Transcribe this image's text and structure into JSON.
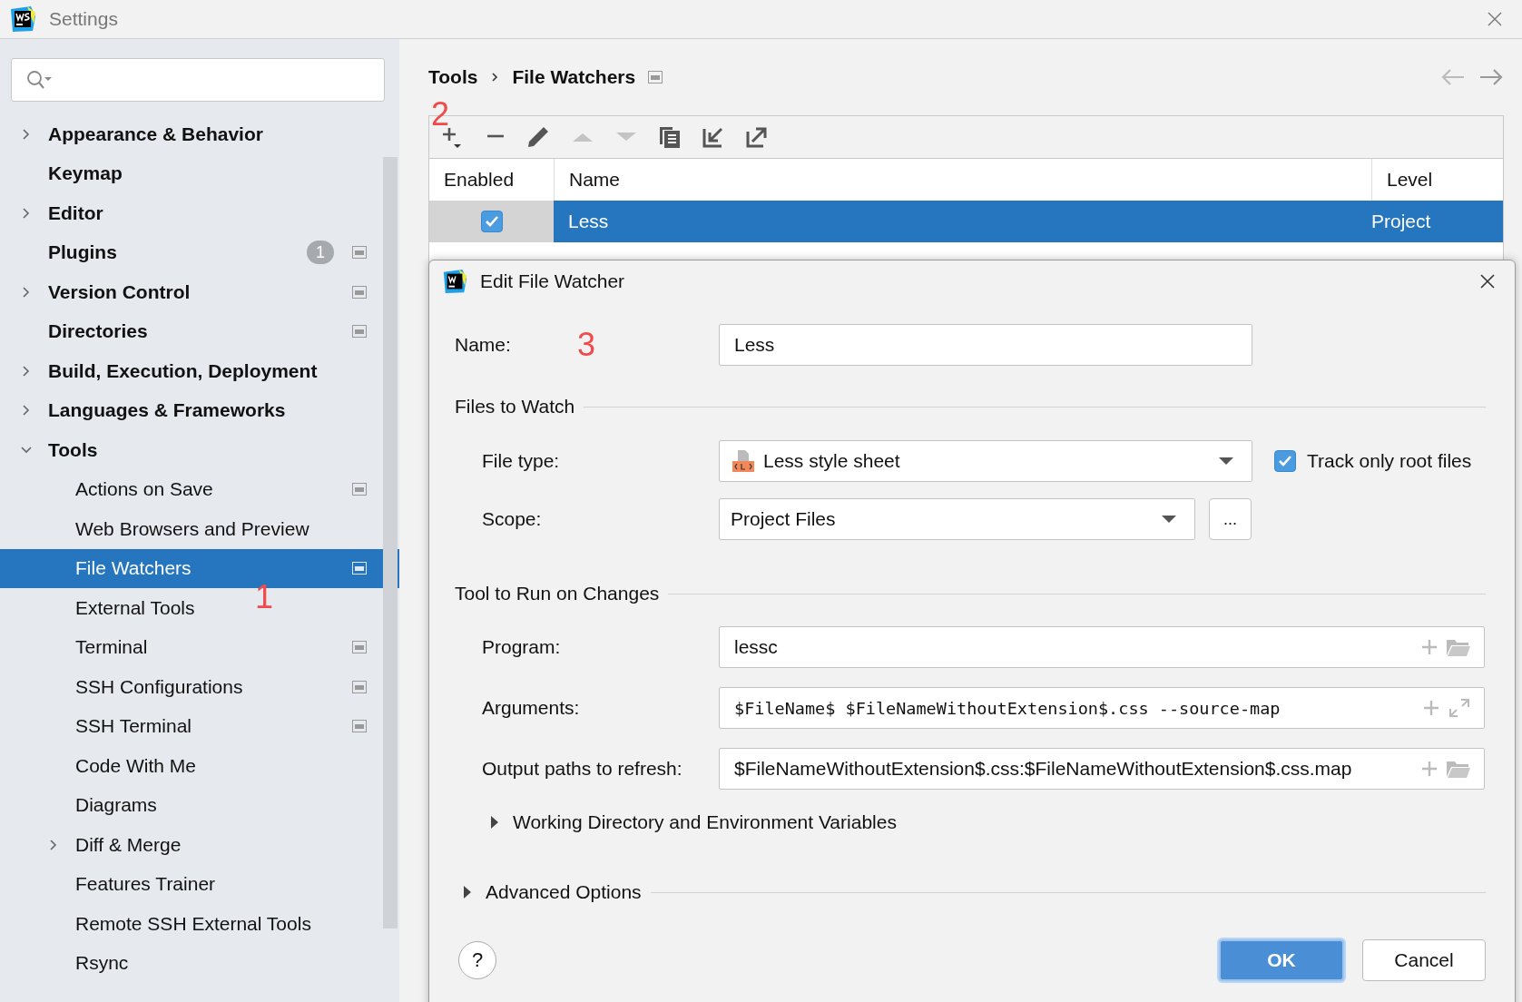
{
  "window": {
    "title": "Settings"
  },
  "sidebar": {
    "items": [
      {
        "label": "Appearance & Behavior",
        "kind": "group",
        "expanded": false,
        "selected": false
      },
      {
        "label": "Keymap",
        "kind": "page",
        "selected": false
      },
      {
        "label": "Editor",
        "kind": "group",
        "expanded": false,
        "selected": false
      },
      {
        "label": "Plugins",
        "kind": "page",
        "selected": false,
        "badge": "1",
        "project_icon": true
      },
      {
        "label": "Version Control",
        "kind": "group",
        "expanded": false,
        "selected": false,
        "project_icon": true
      },
      {
        "label": "Directories",
        "kind": "page",
        "selected": false,
        "project_icon": true
      },
      {
        "label": "Build, Execution, Deployment",
        "kind": "group",
        "expanded": false,
        "selected": false
      },
      {
        "label": "Languages & Frameworks",
        "kind": "group",
        "expanded": false,
        "selected": false
      },
      {
        "label": "Tools",
        "kind": "group",
        "expanded": true,
        "selected": false,
        "children": [
          {
            "label": "Actions on Save",
            "kind": "page",
            "selected": false,
            "project_icon": true
          },
          {
            "label": "Web Browsers and Preview",
            "kind": "page",
            "selected": false
          },
          {
            "label": "File Watchers",
            "kind": "page",
            "selected": true,
            "project_icon": true
          },
          {
            "label": "External Tools",
            "kind": "page",
            "selected": false
          },
          {
            "label": "Terminal",
            "kind": "page",
            "selected": false,
            "project_icon": true
          },
          {
            "label": "SSH Configurations",
            "kind": "page",
            "selected": false,
            "project_icon": true
          },
          {
            "label": "SSH Terminal",
            "kind": "page",
            "selected": false,
            "project_icon": true
          },
          {
            "label": "Code With Me",
            "kind": "page",
            "selected": false
          },
          {
            "label": "Diagrams",
            "kind": "page",
            "selected": false
          },
          {
            "label": "Diff & Merge",
            "kind": "group",
            "expanded": false,
            "selected": false
          },
          {
            "label": "Features Trainer",
            "kind": "page",
            "selected": false
          },
          {
            "label": "Remote SSH External Tools",
            "kind": "page",
            "selected": false
          },
          {
            "label": "Rsync",
            "kind": "page",
            "selected": false
          }
        ]
      }
    ]
  },
  "breadcrumb": [
    "Tools",
    "File Watchers"
  ],
  "table": {
    "columns": [
      "Enabled",
      "Name",
      "Level"
    ],
    "rows": [
      {
        "enabled": true,
        "name": "Less",
        "level": "Project",
        "selected": true
      }
    ]
  },
  "dialog": {
    "title": "Edit File Watcher",
    "name": {
      "label": "Name:",
      "value": "Less"
    },
    "files_section": "Files to Watch",
    "file_type": {
      "label": "File type:",
      "value": "Less style sheet"
    },
    "track_root": {
      "label": "Track only root files",
      "checked": true
    },
    "scope": {
      "label": "Scope:",
      "value": "Project Files",
      "button": "..."
    },
    "tool_section": "Tool to Run on Changes",
    "program": {
      "label": "Program:",
      "value": "lessc"
    },
    "arguments": {
      "label": "Arguments:",
      "value": "$FileName$ $FileNameWithoutExtension$.css --source-map"
    },
    "output": {
      "label": "Output paths to refresh:",
      "value": "$FileNameWithoutExtension$.css:$FileNameWithoutExtension$.css.map"
    },
    "working_dir": {
      "label": "Working Directory and Environment Variables",
      "expanded": false
    },
    "advanced": {
      "label": "Advanced Options",
      "expanded": false
    },
    "help": "?",
    "ok": "OK",
    "cancel": "Cancel"
  },
  "annotations": [
    "1",
    "2",
    "3"
  ]
}
